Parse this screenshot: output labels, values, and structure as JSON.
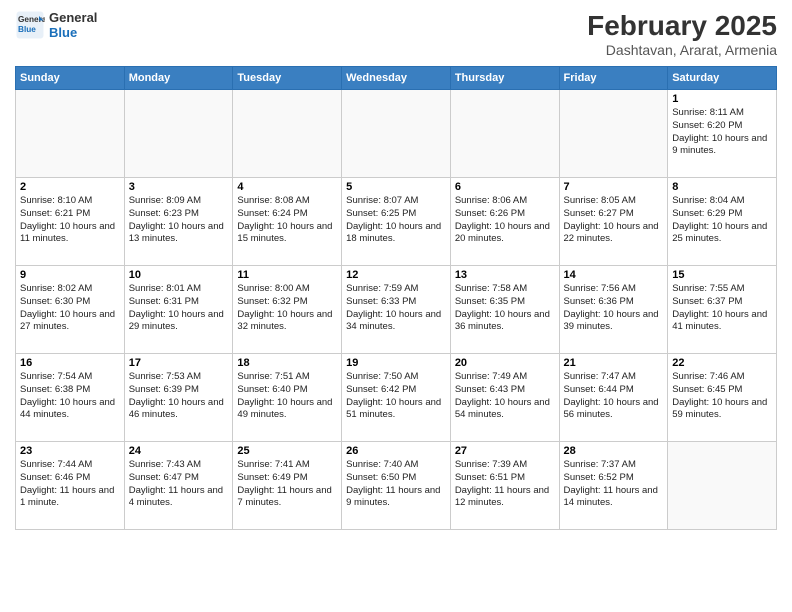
{
  "logo": {
    "general": "General",
    "blue": "Blue"
  },
  "title": "February 2025",
  "subtitle": "Dashtavan, Ararat, Armenia",
  "days": [
    "Sunday",
    "Monday",
    "Tuesday",
    "Wednesday",
    "Thursday",
    "Friday",
    "Saturday"
  ],
  "weeks": [
    [
      {
        "num": "",
        "info": ""
      },
      {
        "num": "",
        "info": ""
      },
      {
        "num": "",
        "info": ""
      },
      {
        "num": "",
        "info": ""
      },
      {
        "num": "",
        "info": ""
      },
      {
        "num": "",
        "info": ""
      },
      {
        "num": "1",
        "info": "Sunrise: 8:11 AM\nSunset: 6:20 PM\nDaylight: 10 hours and 9 minutes."
      }
    ],
    [
      {
        "num": "2",
        "info": "Sunrise: 8:10 AM\nSunset: 6:21 PM\nDaylight: 10 hours and 11 minutes."
      },
      {
        "num": "3",
        "info": "Sunrise: 8:09 AM\nSunset: 6:23 PM\nDaylight: 10 hours and 13 minutes."
      },
      {
        "num": "4",
        "info": "Sunrise: 8:08 AM\nSunset: 6:24 PM\nDaylight: 10 hours and 15 minutes."
      },
      {
        "num": "5",
        "info": "Sunrise: 8:07 AM\nSunset: 6:25 PM\nDaylight: 10 hours and 18 minutes."
      },
      {
        "num": "6",
        "info": "Sunrise: 8:06 AM\nSunset: 6:26 PM\nDaylight: 10 hours and 20 minutes."
      },
      {
        "num": "7",
        "info": "Sunrise: 8:05 AM\nSunset: 6:27 PM\nDaylight: 10 hours and 22 minutes."
      },
      {
        "num": "8",
        "info": "Sunrise: 8:04 AM\nSunset: 6:29 PM\nDaylight: 10 hours and 25 minutes."
      }
    ],
    [
      {
        "num": "9",
        "info": "Sunrise: 8:02 AM\nSunset: 6:30 PM\nDaylight: 10 hours and 27 minutes."
      },
      {
        "num": "10",
        "info": "Sunrise: 8:01 AM\nSunset: 6:31 PM\nDaylight: 10 hours and 29 minutes."
      },
      {
        "num": "11",
        "info": "Sunrise: 8:00 AM\nSunset: 6:32 PM\nDaylight: 10 hours and 32 minutes."
      },
      {
        "num": "12",
        "info": "Sunrise: 7:59 AM\nSunset: 6:33 PM\nDaylight: 10 hours and 34 minutes."
      },
      {
        "num": "13",
        "info": "Sunrise: 7:58 AM\nSunset: 6:35 PM\nDaylight: 10 hours and 36 minutes."
      },
      {
        "num": "14",
        "info": "Sunrise: 7:56 AM\nSunset: 6:36 PM\nDaylight: 10 hours and 39 minutes."
      },
      {
        "num": "15",
        "info": "Sunrise: 7:55 AM\nSunset: 6:37 PM\nDaylight: 10 hours and 41 minutes."
      }
    ],
    [
      {
        "num": "16",
        "info": "Sunrise: 7:54 AM\nSunset: 6:38 PM\nDaylight: 10 hours and 44 minutes."
      },
      {
        "num": "17",
        "info": "Sunrise: 7:53 AM\nSunset: 6:39 PM\nDaylight: 10 hours and 46 minutes."
      },
      {
        "num": "18",
        "info": "Sunrise: 7:51 AM\nSunset: 6:40 PM\nDaylight: 10 hours and 49 minutes."
      },
      {
        "num": "19",
        "info": "Sunrise: 7:50 AM\nSunset: 6:42 PM\nDaylight: 10 hours and 51 minutes."
      },
      {
        "num": "20",
        "info": "Sunrise: 7:49 AM\nSunset: 6:43 PM\nDaylight: 10 hours and 54 minutes."
      },
      {
        "num": "21",
        "info": "Sunrise: 7:47 AM\nSunset: 6:44 PM\nDaylight: 10 hours and 56 minutes."
      },
      {
        "num": "22",
        "info": "Sunrise: 7:46 AM\nSunset: 6:45 PM\nDaylight: 10 hours and 59 minutes."
      }
    ],
    [
      {
        "num": "23",
        "info": "Sunrise: 7:44 AM\nSunset: 6:46 PM\nDaylight: 11 hours and 1 minute."
      },
      {
        "num": "24",
        "info": "Sunrise: 7:43 AM\nSunset: 6:47 PM\nDaylight: 11 hours and 4 minutes."
      },
      {
        "num": "25",
        "info": "Sunrise: 7:41 AM\nSunset: 6:49 PM\nDaylight: 11 hours and 7 minutes."
      },
      {
        "num": "26",
        "info": "Sunrise: 7:40 AM\nSunset: 6:50 PM\nDaylight: 11 hours and 9 minutes."
      },
      {
        "num": "27",
        "info": "Sunrise: 7:39 AM\nSunset: 6:51 PM\nDaylight: 11 hours and 12 minutes."
      },
      {
        "num": "28",
        "info": "Sunrise: 7:37 AM\nSunset: 6:52 PM\nDaylight: 11 hours and 14 minutes."
      },
      {
        "num": "",
        "info": ""
      }
    ]
  ]
}
